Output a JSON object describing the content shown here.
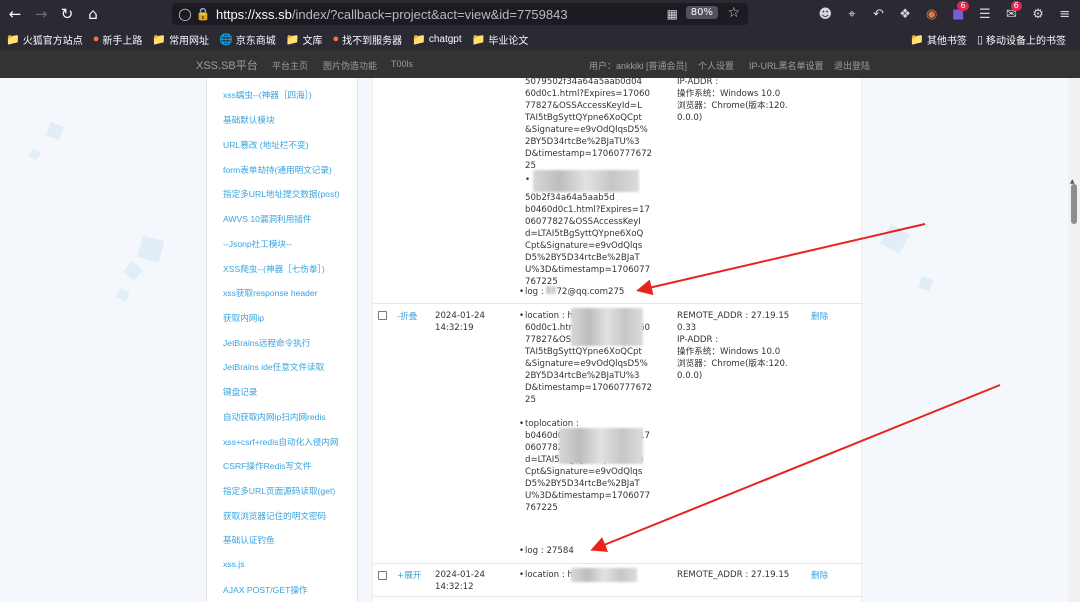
{
  "browser": {
    "url_host": "https://xss.sb",
    "url_path": "/index/?callback=project&act=view&id=7759843",
    "zoom": "80%",
    "badges": [
      "6",
      "6"
    ]
  },
  "bookmarks": {
    "left": [
      "火狐官方站点",
      "新手上路",
      "常用网址",
      "京东商城",
      "文库",
      "找不到服务器",
      "chatgpt",
      "毕业论文"
    ],
    "right": [
      "其他书签",
      "移动设备上的书签"
    ]
  },
  "sitenav": {
    "brand": "XSS.SB平台",
    "links": [
      "平台主页",
      "图片伪造功能",
      "T00ls"
    ],
    "user": "用户：ankkiki [普通会员]",
    "right_links": [
      "个人设置",
      "IP-URL黑名单设置",
      "退出登陆"
    ]
  },
  "sidebar": {
    "items": [
      "xss蠕虫--(神器［四海］)",
      "基础默认模块",
      "URL篡改 (地址栏不变)",
      "form表单劫持(通用明文记录)",
      "指定多URL地址提交数据(post)",
      "AWVS 10漏洞利用插件",
      "--Jsonp社工模块--",
      "XSS爬虫--(神器［七伤拳］)",
      "xss获取response header",
      "获取内网ip",
      "JetBrains远程命令执行",
      "JetBrains ide任意文件读取",
      "键盘记录",
      "自动获取内网ip扫内网redis",
      "xss+csrf+redis自动化入侵内网",
      "CSRF操作Redis写文件",
      "指定多URL页面源码读取(get)",
      "获取浏览器记住的明文密码",
      "基础认证钓鱼",
      "xss.js",
      "AJAX POST/GET操作"
    ]
  },
  "records": [
    {
      "location_tail": [
        "5079502f34a64a5aab0d04",
        "60d0c1.html?Expires=17060",
        "77827&OSSAccessKeyId=L",
        "TAI5tBgSyttQYpne6XoQCpt",
        "&Signature=e9vOdQlqsD5%",
        "2BY5D34rtcBe%2BJaTU%3",
        "D&timestamp=17060777672",
        "25"
      ],
      "toplocation_tail": [
        "50b2f34a64a5aab5d",
        "b0460d0c1.html?Expires=17",
        "06077827&OSSAccessKeyI",
        "d=LTAI5tBgSyttQYpne6XoQ",
        "Cpt&Signature=e9vOdQlqs",
        "D5%2BY5D34rtcBe%2BJaT",
        "U%3D&timestamp=1706077",
        "767225"
      ],
      "log": "log : ",
      "log_tail": "72@qq.com275",
      "sys": [
        "IP-ADDR :",
        "操作系统：Windows 10.0",
        "浏览器：Chrome(版本:120.",
        "0.0.0)"
      ]
    },
    {
      "toggle": "-折叠",
      "date": "2024-01-24",
      "time": "14:32:19",
      "location_label": "location : ",
      "location_head": "h",
      "location_tail": [
        "",
        "60d0c1.html?Expires=17060",
        "77827&OSSAccessKeyId=L",
        "TAI5tBgSyttQYpne6XoQCpt",
        "&Signature=e9vOdQlqsD5%",
        "2BY5D34rtcBe%2BJaTU%3",
        "D&timestamp=17060777672",
        "25"
      ],
      "toplocation_label": "toplocation : ",
      "toplocation_tail": [
        "",
        "",
        "b0460d0c1.html?Expires=17",
        "06077827&OSSAccessKeyI",
        "d=LTAI5tBgSyttQYpne6XoQ",
        "Cpt&Signature=e9vOdQlqs",
        "D5%2BY5D34rtcBe%2BJaT",
        "U%3D&timestamp=1706077",
        "767225"
      ],
      "log": "log : 27584",
      "sys": [
        "REMOTE_ADDR : 27.19.15",
        "0.33",
        "IP-ADDR :",
        "操作系统：Windows 10.0",
        "浏览器：Chrome(版本:120.",
        "0.0.0)"
      ],
      "delete": "删除"
    },
    {
      "toggle": "+展开",
      "date": "2024-01-24",
      "time": "14:32:12",
      "location_label": "location : ",
      "location_head": "h",
      "sys": [
        "REMOTE_ADDR : 27.19.15"
      ],
      "delete": "删除"
    }
  ]
}
